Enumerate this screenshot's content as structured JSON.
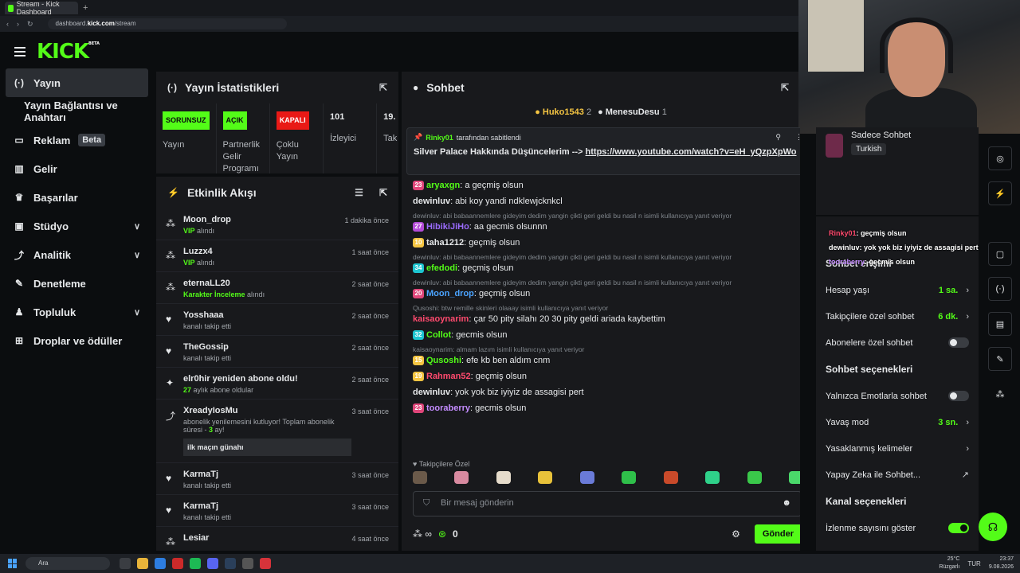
{
  "browser": {
    "tab_title": "Stream - Kick Dashboard",
    "new_tab": "+",
    "url_prefix": "dashboard.",
    "url_domain": "kick.com",
    "url_path": "/stream"
  },
  "logo": {
    "text": "KICK",
    "beta": "BETA"
  },
  "sidebar": {
    "items": [
      {
        "label": "Yayın",
        "icon": "broadcast-icon"
      },
      {
        "label": "Yayın Bağlantısı ve Anahtarı"
      },
      {
        "label": "Reklam",
        "badge": "Beta",
        "icon": "monitor-icon"
      },
      {
        "label": "Gelir",
        "icon": "chart-icon"
      },
      {
        "label": "Başarılar",
        "icon": "trophy-icon"
      },
      {
        "label": "Stüdyo",
        "icon": "studio-icon"
      },
      {
        "label": "Analitik",
        "icon": "analytics-icon"
      },
      {
        "label": "Denetleme",
        "icon": "wrench-icon"
      },
      {
        "label": "Topluluk",
        "icon": "community-icon"
      },
      {
        "label": "Droplar ve ödüller",
        "icon": "drops-icon"
      }
    ]
  },
  "stats": {
    "title": "Yayın İstatistikleri",
    "cols": [
      {
        "badge": "SORUNSUZ",
        "label": "Yayın"
      },
      {
        "badge": "AÇIK",
        "label": "Partnerlik Gelir Programı"
      },
      {
        "badge": "KAPALI",
        "label": "Çoklu Yayın"
      },
      {
        "num": "101",
        "label": "İzleyici"
      },
      {
        "num": "19.",
        "label": "Tak"
      }
    ]
  },
  "activity": {
    "title": "Etkinlik Akışı",
    "items": [
      {
        "name": "Moon_drop",
        "sub_green": "VIP",
        "sub": " alındı",
        "time": "1 dakika önce"
      },
      {
        "name": "Luzzx4",
        "sub_green": "VIP",
        "sub": " alındı",
        "time": "1 saat önce"
      },
      {
        "name": "eternaLL20",
        "sub_green": "Karakter İnceleme",
        "sub": " alındı",
        "time": "2 saat önce"
      },
      {
        "name": "Yosshaaa",
        "sub": "kanalı takip etti",
        "time": "2 saat önce"
      },
      {
        "name": "TheGossip",
        "sub": "kanalı takip etti",
        "time": "2 saat önce"
      },
      {
        "name": "elr0hir yeniden abone oldu!",
        "sub_green": "27",
        "sub": " aylık abone oldular",
        "time": "2 saat önce"
      },
      {
        "name": "XreadyIosMu",
        "sub": "abonelik yenilemesini kutluyor! Toplam abonelik süresi - ",
        "sub_green": "3",
        "sub2": " ay!",
        "quote": "ilk maçın günahı",
        "time": "3 saat önce"
      },
      {
        "name": "KarmaTj",
        "sub": "kanalı takip etti",
        "time": "3 saat önce"
      },
      {
        "name": "KarmaTj",
        "sub": "kanalı takip etti",
        "time": "3 saat önce"
      },
      {
        "name": "Lesiar",
        "sub": "",
        "time": "4 saat önce"
      }
    ]
  },
  "chat": {
    "title": "Sohbet",
    "top_gifters": [
      {
        "name": "Huko1543",
        "count": "2"
      },
      {
        "name": "MenesuDesu",
        "count": "1"
      }
    ],
    "pinned": {
      "by_user": "Rinky01",
      "by_text": "tarafından sabitlendi",
      "text": "Silver Palace Hakkında Düşüncelerim -->",
      "link": "https://www.youtube.com/watch?v=eH_yQzpXpWo"
    },
    "messages": [
      {
        "badge": "23",
        "badge_color": "#e0467a",
        "user": "aryaxgn",
        "user_color": "#53fc18",
        "text": ": a geçmiş olsun"
      },
      {
        "user": "dewinluv",
        "user_color": "#e6e8ea",
        "text": ": abi koy yandi ndklewjcknkcl"
      },
      {
        "reply": "dewinluv: abi babaannemlere gideyim dedim yangin çikti geri geldi bu nasil n isimli kullanıcıya yanıt veriyor",
        "badge": "27",
        "badge_color": "#b44bd8",
        "user": "HibikiJiHo",
        "user_color": "#9b6cff",
        "text": ": aa gecmis olsunnn"
      },
      {
        "badge": "10",
        "badge_color": "#f5c542",
        "user": "taha1212",
        "user_color": "#e6e8ea",
        "text": ": geçmiş olsun"
      },
      {
        "reply": "dewinluv: abi babaannemlere gideyim dedim yangin çikti geri geldi bu nasil n isimli kullanıcıya yanıt veriyor",
        "badge": "34",
        "badge_color": "#1ec6d1",
        "user": "efedodi",
        "user_color": "#53fc18",
        "text": ": geçmiş olsun"
      },
      {
        "reply": "dewinluv: abi babaannemlere gideyim dedim yangin çikti geri geldi bu nasil n isimli kullanıcıya yanıt veriyor",
        "badge": "20",
        "badge_color": "#e0467a",
        "user": "Moon_drop",
        "user_color": "#4aa3ff",
        "text": ": geçmiş olsun"
      },
      {
        "reply": "Qusoshi: btw remille skinleri olaaay isimli kullanıcıya yanıt veriyor",
        "user": "kaisaoynarim",
        "user_color": "#ff4a6e",
        "text": ": çar 50 pity silahı 20 30 pity geldi ariada kaybettim"
      },
      {
        "badge": "32",
        "badge_color": "#1ec6d1",
        "user": "Collot",
        "user_color": "#53fc18",
        "text": ": gecmis olsun"
      },
      {
        "reply": "kaisaoynarim: almam lazım isimli kullanıcıya yanıt veriyor",
        "badge": "15",
        "badge_color": "#f5c542",
        "user": "Qusoshi",
        "user_color": "#53fc18",
        "text": ": efe kb ben aldım cnm"
      },
      {
        "badge": "19",
        "badge_color": "#f5c542",
        "user": "Rahman52",
        "user_color": "#ff4a6e",
        "text": ": geçmiş olsun"
      },
      {
        "user": "dewinluv",
        "user_color": "#e6e8ea",
        "text": ": yok yok biz iyiyiz de assagisi pert"
      },
      {
        "badge": "23",
        "badge_color": "#e0467a",
        "user": "tooraberry",
        "user_color": "#c48cff",
        "text": ": gecmis olsun"
      }
    ],
    "emote_label": "Takipçilere Özel",
    "input_placeholder": "Bir mesaj gönderin",
    "points_value": "0",
    "send_label": "Gönder"
  },
  "chat_mode": {
    "title": "Sadece Sohbet",
    "language": "Turkish"
  },
  "overlay": {
    "lines": [
      {
        "user": "Rinky01",
        "text": ": geçmiş olsun"
      },
      {
        "user": "dewinluv",
        "text": ": yok yok biz iyiyiz de assagisi pert"
      },
      {
        "user": "tooraberry",
        "text": ": gecmis olsun"
      }
    ]
  },
  "settings": {
    "section1_title": "Sohbet erişimi",
    "account_age": {
      "label": "Hesap yaşı",
      "value": "1 sa."
    },
    "follower_chat": {
      "label": "Takipçilere özel sohbet",
      "value": "6 dk."
    },
    "sub_chat": {
      "label": "Abonelere özel sohbet"
    },
    "section2_title": "Sohbet seçenekleri",
    "emote_only": {
      "label": "Yalnızca Emotlarla sohbet"
    },
    "slow_mode": {
      "label": "Yavaş mod",
      "value": "3 sn."
    },
    "banned_words": {
      "label": "Yasaklanmış kelimeler"
    },
    "ai_chat": {
      "label": "Yapay Zeka ile Sohbet..."
    },
    "section3_title": "Kanal seçenekleri",
    "show_viewers": {
      "label": "İzlenme sayısını göster"
    }
  },
  "taskbar": {
    "search": "Ara",
    "weather": "25°C",
    "weather_sub": "Rüzgarlı",
    "lang": "TUR",
    "time": "23:37",
    "date": "9.08.2026"
  },
  "colors": {
    "accent": "#53fc18",
    "panel": "#18191c",
    "bg": "#0b0d0f"
  }
}
